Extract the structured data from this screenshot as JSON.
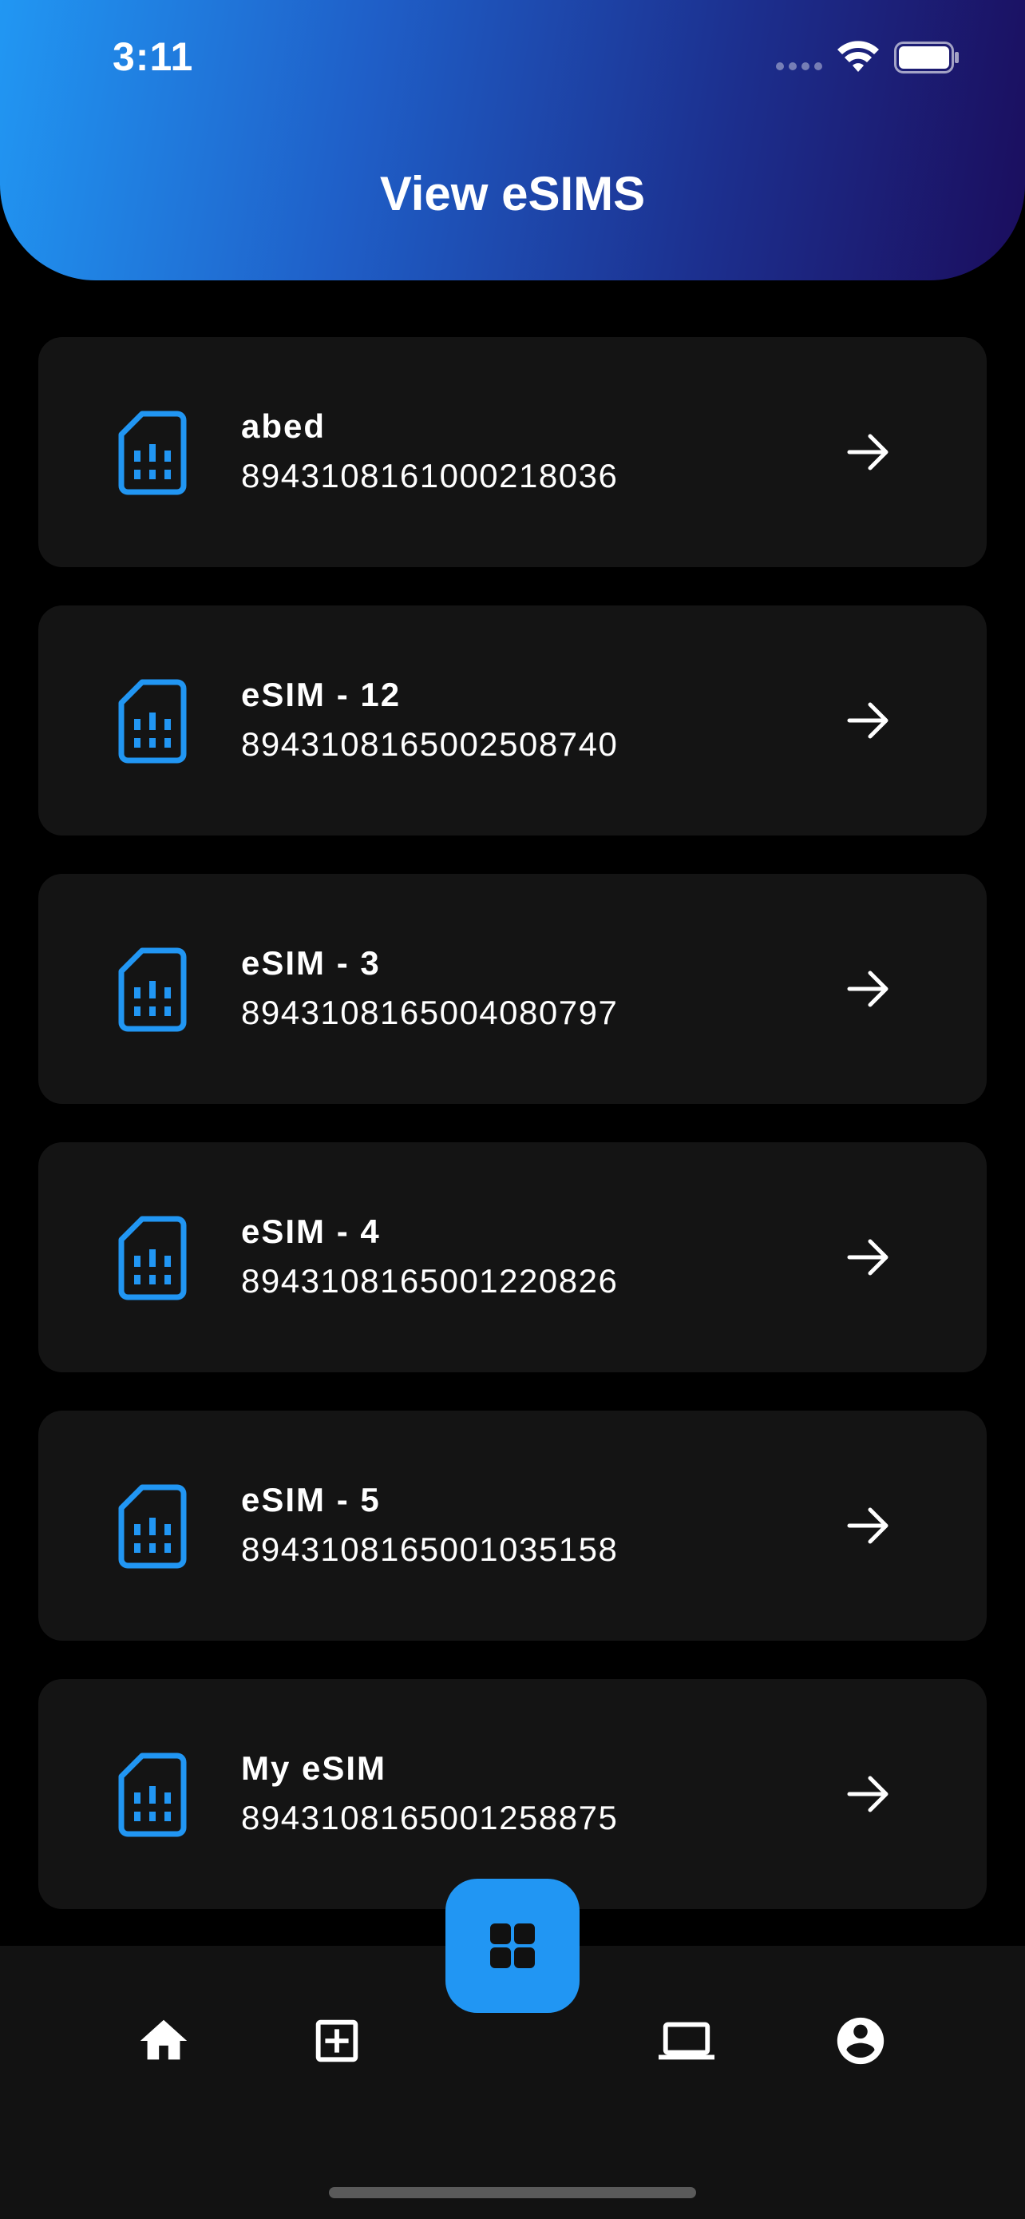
{
  "status_bar": {
    "time": "3:11"
  },
  "header": {
    "title": "View eSIMS"
  },
  "esims": [
    {
      "name": "abed",
      "number": "8943108161000218036"
    },
    {
      "name": "eSIM - 12",
      "number": "8943108165002508740"
    },
    {
      "name": "eSIM - 3",
      "number": "8943108165004080797"
    },
    {
      "name": "eSIM - 4",
      "number": "8943108165001220826"
    },
    {
      "name": "eSIM - 5",
      "number": "8943108165001035158"
    },
    {
      "name": "My eSIM",
      "number": "8943108165001258875"
    }
  ],
  "icons": {
    "sim": "sim-card-icon",
    "arrow": "arrow-right-icon",
    "fab": "grid-icon",
    "nav": [
      "home-icon",
      "add-box-icon",
      "laptop-icon",
      "account-circle-icon"
    ]
  },
  "colors": {
    "accent": "#2196f3",
    "header_gradient_start": "#2197f3",
    "header_gradient_end": "#1b0d5d",
    "card_bg": "#141414",
    "background": "#000000"
  }
}
